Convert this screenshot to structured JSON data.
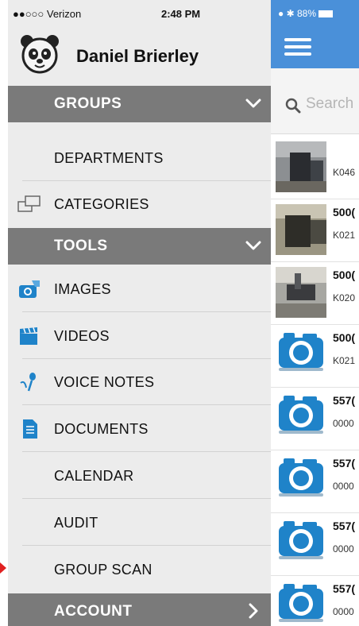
{
  "status_bar": {
    "carrier": "●●○○○ Verizon",
    "time": "2:48 PM",
    "battery": "88%"
  },
  "profile": {
    "name": "Daniel Brierley"
  },
  "menu": {
    "groups_header": "GROUPS",
    "departments": "DEPARTMENTS",
    "categories": "CATEGORIES",
    "tools_header": "TOOLS",
    "images": "IMAGES",
    "videos": "VIDEOS",
    "voice_notes": "VOICE NOTES",
    "documents": "DOCUMENTS",
    "calendar": "CALENDAR",
    "audit": "AUDIT",
    "group_scan": "GROUP SCAN",
    "account_header": "ACCOUNT"
  },
  "search": {
    "placeholder": "Search"
  },
  "list": [
    {
      "title": "",
      "sub": "K046"
    },
    {
      "title": "500(",
      "sub": "K021"
    },
    {
      "title": "500(",
      "sub": "K020"
    },
    {
      "title": "500(",
      "sub": "K021"
    },
    {
      "title": "557(",
      "sub": "0000"
    },
    {
      "title": "557(",
      "sub": "0000"
    },
    {
      "title": "557(",
      "sub": "0000"
    },
    {
      "title": "557(",
      "sub": "0000"
    }
  ],
  "colors": {
    "accent": "#4a90d9",
    "section": "#7a7a7a",
    "drawer": "#ececec",
    "camera": "#1f83c9"
  }
}
